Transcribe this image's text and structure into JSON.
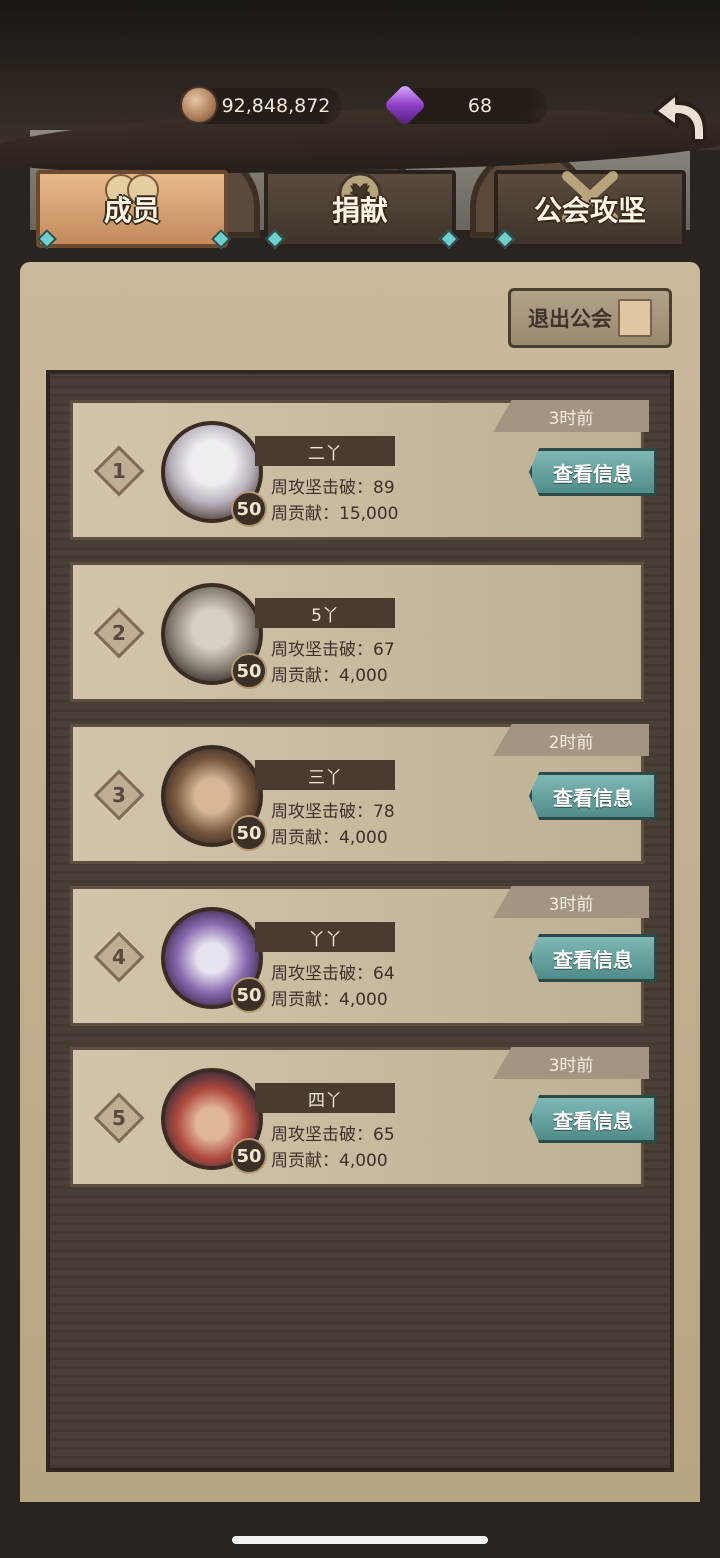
{
  "header": {
    "coins": "92,848,872",
    "gems": "68"
  },
  "tabs": [
    {
      "label": "成员",
      "active": true,
      "icon": "members-icon"
    },
    {
      "label": "捐献",
      "active": false,
      "icon": "donate-icon"
    },
    {
      "label": "公会攻坚",
      "active": false,
      "icon": "crossed-swords-icon"
    }
  ],
  "actions": {
    "leave_guild": "退出公会"
  },
  "members": [
    {
      "rank": "1",
      "name": "二丫",
      "level": "50",
      "kills_label": "周攻坚击破：",
      "kills": "89",
      "contrib_label": "周贡献：",
      "contrib": "15,000",
      "last_seen": "3时前",
      "view_label": "查看信息"
    },
    {
      "rank": "2",
      "name": "5丫",
      "level": "50",
      "kills_label": "周攻坚击破：",
      "kills": "67",
      "contrib_label": "周贡献：",
      "contrib": "4,000",
      "last_seen": "",
      "view_label": ""
    },
    {
      "rank": "3",
      "name": "三丫",
      "level": "50",
      "kills_label": "周攻坚击破：",
      "kills": "78",
      "contrib_label": "周贡献：",
      "contrib": "4,000",
      "last_seen": "2时前",
      "view_label": "查看信息"
    },
    {
      "rank": "4",
      "name": "丫丫",
      "level": "50",
      "kills_label": "周攻坚击破：",
      "kills": "64",
      "contrib_label": "周贡献：",
      "contrib": "4,000",
      "last_seen": "3时前",
      "view_label": "查看信息"
    },
    {
      "rank": "5",
      "name": "四丫",
      "level": "50",
      "kills_label": "周攻坚击破：",
      "kills": "65",
      "contrib_label": "周贡献：",
      "contrib": "4,000",
      "last_seen": "3时前",
      "view_label": "查看信息"
    }
  ]
}
